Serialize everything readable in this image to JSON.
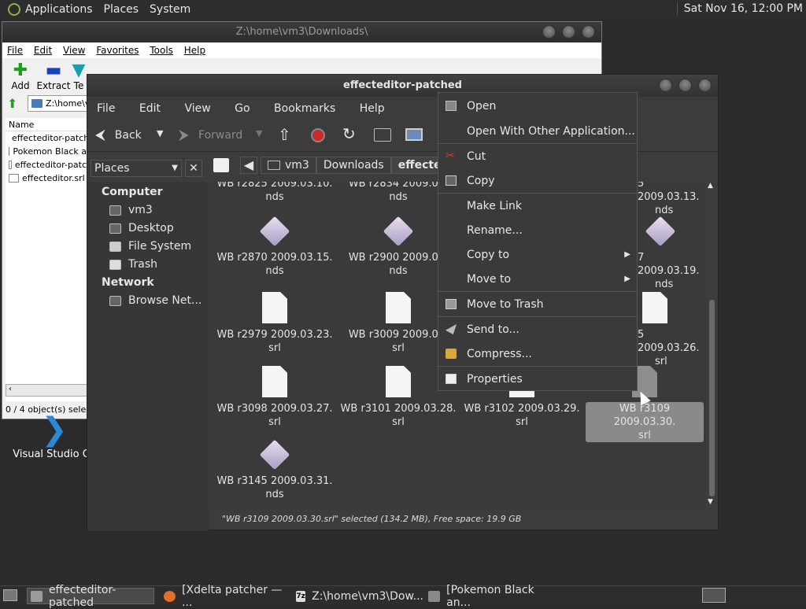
{
  "top_panel": {
    "menus": [
      "Applications",
      "Places",
      "System"
    ],
    "clock": "Sat Nov 16, 12:00 PM"
  },
  "zip_window": {
    "title": "Z:\\home\\vm3\\Downloads\\",
    "menu": [
      "File",
      "Edit",
      "View",
      "Favorites",
      "Tools",
      "Help"
    ],
    "toolbar": [
      "Add",
      "Extract",
      "Te"
    ],
    "address": "Z:\\home\\v",
    "column_name": "Name",
    "files": [
      {
        "name": "effecteditor-patche",
        "type": "folder"
      },
      {
        "name": "Pokemon Black an",
        "type": "folder"
      },
      {
        "name": "effecteditor-patch",
        "type": "file"
      },
      {
        "name": "effecteditor.srl",
        "type": "file"
      }
    ],
    "status": "0 / 4 object(s) selecte"
  },
  "desktop_icon": {
    "label": "Visual Studio Co"
  },
  "caja": {
    "title": "effecteditor-patched",
    "menu": [
      "File",
      "Edit",
      "View",
      "Go",
      "Bookmarks",
      "Help"
    ],
    "toolbar": {
      "back": "Back",
      "forward": "Forward"
    },
    "location": {
      "crumbs": [
        "vm3",
        "Downloads",
        "effecteditor-"
      ]
    },
    "sidebar": {
      "selector": "Places",
      "sections": [
        {
          "header": "Computer",
          "items": [
            "vm3",
            "Desktop",
            "File System",
            "Trash"
          ]
        },
        {
          "header": "Network",
          "items": [
            "Browse Net..."
          ]
        }
      ]
    },
    "files": [
      {
        "l1": "WB r2825 2009.03.10.",
        "l2": "nds",
        "icon": "none"
      },
      {
        "l1": "WB r2834 2009.03.",
        "l2": "nds",
        "icon": "none"
      },
      {
        "l1": "",
        "l2": "",
        "icon": "none"
      },
      {
        "l1": "5 2009.03.13.",
        "l2": "nds",
        "icon": "none"
      },
      {
        "l1": "WB r2870 2009.03.15.",
        "l2": "nds",
        "icon": "nds"
      },
      {
        "l1": "WB r2900 2009.03.",
        "l2": "nds",
        "icon": "nds"
      },
      {
        "l1": "",
        "l2": "",
        "icon": "none"
      },
      {
        "l1": "7 2009.03.19.",
        "l2": "nds",
        "icon": "nds"
      },
      {
        "l1": "WB r2979 2009.03.23.",
        "l2": "srl",
        "icon": "doc"
      },
      {
        "l1": "WB r3009 2009.03.",
        "l2": "srl",
        "icon": "doc"
      },
      {
        "l1": "",
        "l2": "",
        "icon": "none"
      },
      {
        "l1": "5 2009.03.26.",
        "l2": "srl",
        "icon": "doc"
      },
      {
        "l1": "WB r3098 2009.03.27.",
        "l2": "srl",
        "icon": "doc"
      },
      {
        "l1": "WB r3101 2009.03.28.",
        "l2": "srl",
        "icon": "doc"
      },
      {
        "l1": "WB r3102 2009.03.29.",
        "l2": "srl",
        "icon": "none"
      },
      {
        "l1": "WB r3109 2009.03.30.",
        "l2": "srl",
        "icon": "none",
        "selected": true
      },
      {
        "l1": "WB r3145 2009.03.31.",
        "l2": "nds",
        "icon": "nds"
      }
    ],
    "status": "\"WB r3109 2009.03.30.srl\" selected (134.2 MB), Free space: 19.9 GB"
  },
  "context_menu": [
    {
      "label": "Open",
      "icon": "open-icon"
    },
    {
      "label": "Open With Other Application...",
      "icon": ""
    },
    {
      "label": "Cut",
      "icon": "cut-icon"
    },
    {
      "label": "Copy",
      "icon": "copy-icon"
    },
    {
      "label": "Make Link",
      "icon": ""
    },
    {
      "label": "Rename...",
      "icon": ""
    },
    {
      "label": "Copy to",
      "icon": "",
      "submenu": true
    },
    {
      "label": "Move to",
      "icon": "",
      "submenu": true
    },
    {
      "label": "Move to Trash",
      "icon": "trash-icon"
    },
    {
      "label": "Send to...",
      "icon": "send-icon"
    },
    {
      "label": "Compress...",
      "icon": "compress-icon"
    },
    {
      "label": "Properties",
      "icon": "properties-icon"
    }
  ],
  "taskbar": [
    {
      "label": "effecteditor-patched",
      "active": true
    },
    {
      "label": "[Xdelta patcher — ..."
    },
    {
      "label": "Z:\\home\\vm3\\Dow..."
    },
    {
      "label": "[Pokemon Black an..."
    }
  ],
  "colors": {
    "panel": "#2d2d2d",
    "window": "#3c3c3c",
    "selection": "#8a8a8a",
    "accent": "#c92a2a"
  }
}
